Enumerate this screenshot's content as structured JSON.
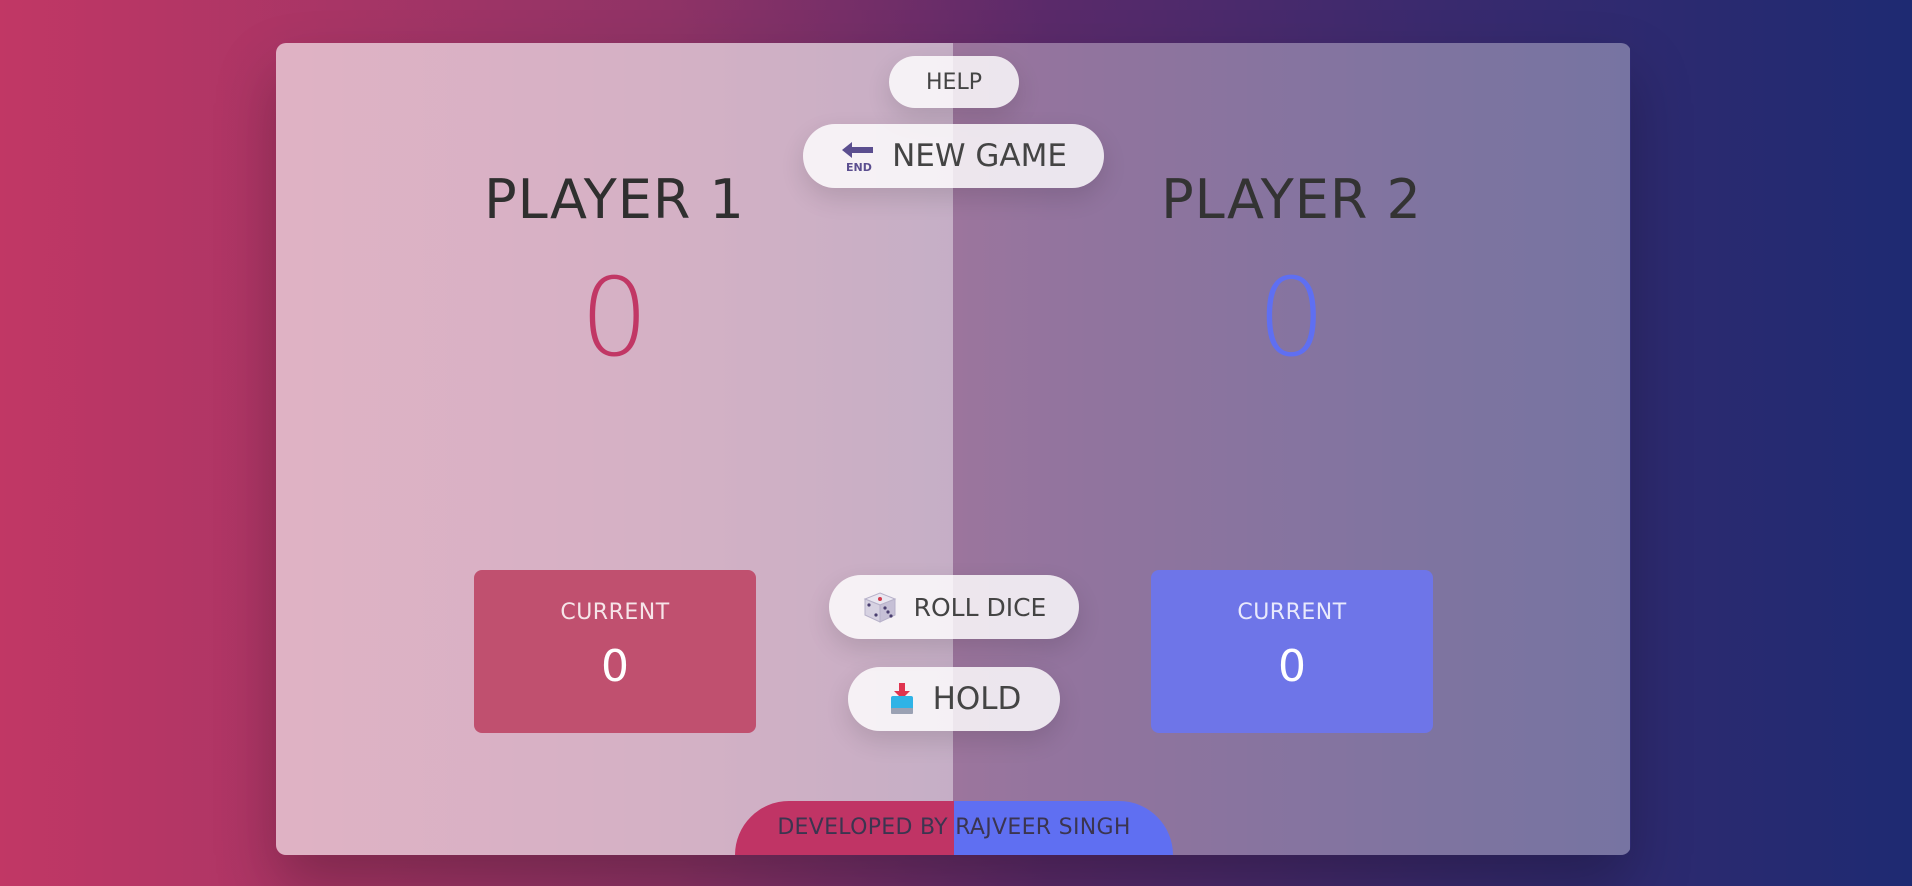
{
  "help_button": {
    "label": "HELP"
  },
  "new_game_button": {
    "label": "NEW GAME",
    "icon": "end-arrow-icon"
  },
  "player1": {
    "name": "PLAYER 1",
    "score": "0",
    "current_label": "CURRENT",
    "current_value": "0",
    "color": "#c13765"
  },
  "player2": {
    "name": "PLAYER 2",
    "score": "0",
    "current_label": "CURRENT",
    "current_value": "0",
    "color": "#5f6ff2"
  },
  "roll_button": {
    "label": "ROLL DICE",
    "icon": "dice-icon"
  },
  "hold_button": {
    "label": "HOLD",
    "icon": "inbox-tray-icon"
  },
  "footer": {
    "text": "DEVELOPED BY RAJVEER SINGH"
  }
}
